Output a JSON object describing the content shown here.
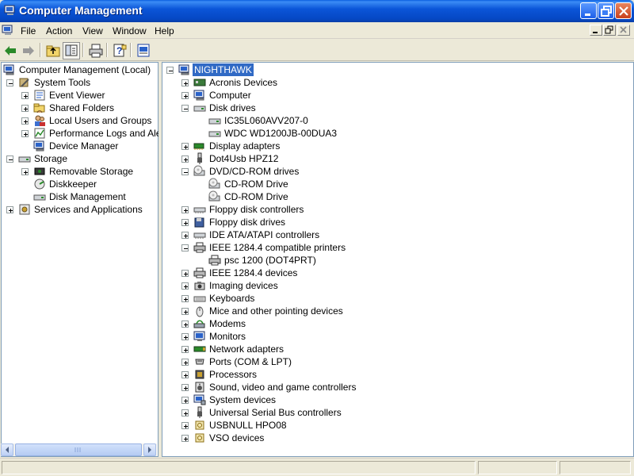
{
  "window": {
    "title": "Computer Management"
  },
  "menu": [
    "File",
    "Action",
    "View",
    "Window",
    "Help"
  ],
  "toolbar": [
    "back-icon",
    "forward-icon",
    "up-folder-icon",
    "show-hide-tree-icon",
    "print-icon",
    "help-icon",
    "properties-icon"
  ],
  "left_tree": [
    {
      "label": "Computer Management (Local)",
      "icon": "computer-management-icon",
      "expander": "minus"
    },
    {
      "label": "System Tools",
      "icon": "system-tools-icon",
      "expander": "minus"
    },
    {
      "label": "Event Viewer",
      "icon": "event-viewer-icon",
      "expander": "plus"
    },
    {
      "label": "Shared Folders",
      "icon": "shared-folders-icon",
      "expander": "plus"
    },
    {
      "label": "Local Users and Groups",
      "icon": "users-icon",
      "expander": "plus"
    },
    {
      "label": "Performance Logs and Alerts",
      "icon": "performance-icon",
      "expander": "plus"
    },
    {
      "label": "Device Manager",
      "icon": "device-manager-icon",
      "expander": "none"
    },
    {
      "label": "Storage",
      "icon": "storage-icon",
      "expander": "minus"
    },
    {
      "label": "Removable Storage",
      "icon": "removable-storage-icon",
      "expander": "plus"
    },
    {
      "label": "Diskkeeper",
      "icon": "diskkeeper-icon",
      "expander": "none"
    },
    {
      "label": "Disk Management",
      "icon": "disk-management-icon",
      "expander": "none"
    },
    {
      "label": "Services and Applications",
      "icon": "services-icon",
      "expander": "plus"
    }
  ],
  "device_tree": [
    {
      "label": "NIGHTHAWK",
      "icon": "computer-icon",
      "expander": "minus",
      "selected": true
    },
    {
      "label": "Acronis Devices",
      "icon": "device-icon",
      "expander": "plus"
    },
    {
      "label": "Computer",
      "icon": "computer-icon",
      "expander": "plus"
    },
    {
      "label": "Disk drives",
      "icon": "disk-drive-icon",
      "expander": "minus"
    },
    {
      "label": "IC35L060AVV207-0",
      "icon": "disk-drive-icon",
      "expander": "none"
    },
    {
      "label": "WDC WD1200JB-00DUA3",
      "icon": "disk-drive-icon",
      "expander": "none"
    },
    {
      "label": "Display adapters",
      "icon": "display-adapter-icon",
      "expander": "plus"
    },
    {
      "label": "Dot4Usb HPZ12",
      "icon": "usb-icon",
      "expander": "plus"
    },
    {
      "label": "DVD/CD-ROM drives",
      "icon": "cd-drive-icon",
      "expander": "minus"
    },
    {
      "label": "CD-ROM Drive",
      "icon": "cd-drive-icon",
      "expander": "none"
    },
    {
      "label": "CD-ROM Drive",
      "icon": "cd-drive-icon",
      "expander": "none"
    },
    {
      "label": "Floppy disk controllers",
      "icon": "controller-icon",
      "expander": "plus"
    },
    {
      "label": "Floppy disk drives",
      "icon": "floppy-icon",
      "expander": "plus"
    },
    {
      "label": "IDE ATA/ATAPI controllers",
      "icon": "controller-icon",
      "expander": "plus"
    },
    {
      "label": "IEEE 1284.4 compatible printers",
      "icon": "printer-icon",
      "expander": "minus"
    },
    {
      "label": "psc 1200 (DOT4PRT)",
      "icon": "printer-icon",
      "expander": "none"
    },
    {
      "label": "IEEE 1284.4 devices",
      "icon": "printer-icon",
      "expander": "plus"
    },
    {
      "label": "Imaging devices",
      "icon": "imaging-icon",
      "expander": "plus"
    },
    {
      "label": "Keyboards",
      "icon": "keyboard-icon",
      "expander": "plus"
    },
    {
      "label": "Mice and other pointing devices",
      "icon": "mouse-icon",
      "expander": "plus"
    },
    {
      "label": "Modems",
      "icon": "modem-icon",
      "expander": "plus"
    },
    {
      "label": "Monitors",
      "icon": "monitor-icon",
      "expander": "plus"
    },
    {
      "label": "Network adapters",
      "icon": "network-icon",
      "expander": "plus"
    },
    {
      "label": "Ports (COM & LPT)",
      "icon": "port-icon",
      "expander": "plus"
    },
    {
      "label": "Processors",
      "icon": "processor-icon",
      "expander": "plus"
    },
    {
      "label": "Sound, video and game controllers",
      "icon": "sound-icon",
      "expander": "plus"
    },
    {
      "label": "System devices",
      "icon": "system-device-icon",
      "expander": "plus"
    },
    {
      "label": "Universal Serial Bus controllers",
      "icon": "usb-icon",
      "expander": "plus"
    },
    {
      "label": "USBNULL HPO08",
      "icon": "unknown-device-icon",
      "expander": "plus"
    },
    {
      "label": "VSO devices",
      "icon": "unknown-device-icon",
      "expander": "plus"
    }
  ],
  "colors": {
    "titlebar": "#0548c4",
    "selection": "#316ac5",
    "pane_border": "#7f9db9"
  }
}
